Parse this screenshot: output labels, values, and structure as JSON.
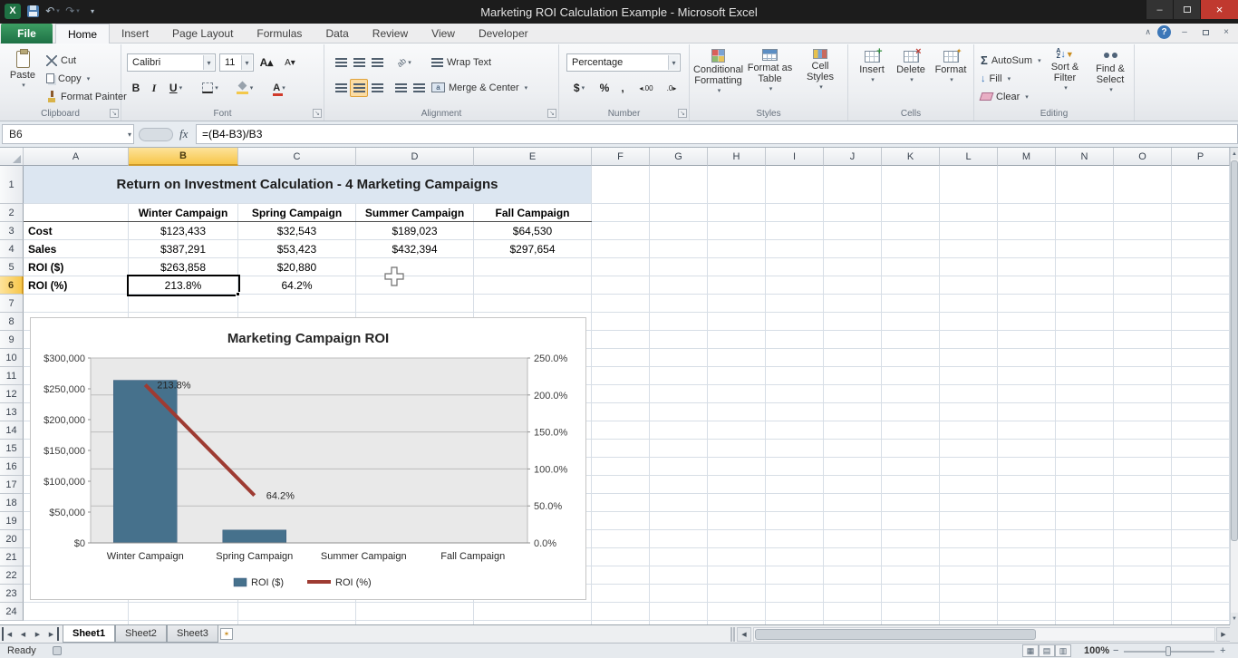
{
  "title_bar": {
    "title": "Marketing ROI Calculation Example  -  Microsoft Excel"
  },
  "ribbon": {
    "file_tab": "File",
    "tabs": [
      "Home",
      "Insert",
      "Page Layout",
      "Formulas",
      "Data",
      "Review",
      "View",
      "Developer"
    ],
    "active_tab": "Home",
    "clipboard": {
      "label": "Clipboard",
      "paste": "Paste",
      "cut": "Cut",
      "copy": "Copy",
      "format_painter": "Format Painter"
    },
    "font": {
      "label": "Font",
      "font_name": "Calibri",
      "font_size": "11"
    },
    "alignment": {
      "label": "Alignment",
      "wrap_text": "Wrap Text",
      "merge_center": "Merge & Center"
    },
    "number": {
      "label": "Number",
      "format": "Percentage"
    },
    "styles": {
      "label": "Styles",
      "conditional_formatting": "Conditional Formatting",
      "format_as_table": "Format as Table",
      "cell_styles": "Cell Styles"
    },
    "cells": {
      "label": "Cells",
      "insert": "Insert",
      "delete": "Delete",
      "format": "Format"
    },
    "editing": {
      "label": "Editing",
      "autosum": "AutoSum",
      "fill": "Fill",
      "clear": "Clear",
      "sort_filter": "Sort & Filter",
      "find_select": "Find & Select"
    }
  },
  "formula_bar": {
    "name_box": "B6",
    "fx": "fx",
    "formula": "=(B4-B3)/B3"
  },
  "sheet": {
    "columns": [
      "A",
      "B",
      "C",
      "D",
      "E",
      "F",
      "G",
      "H",
      "I",
      "J",
      "K",
      "L",
      "M",
      "N",
      "O",
      "P"
    ],
    "visible_rows": 24,
    "selected_column": "B",
    "selected_row": 6,
    "selection": {
      "ref": "B6",
      "value": "213.8%"
    },
    "cells": [
      {
        "ref": "A1",
        "text": "Return on Investment Calculation - 4 Marketing Campaigns"
      },
      {
        "ref": "B2",
        "text": "Winter Campaign"
      },
      {
        "ref": "C2",
        "text": "Spring Campaign"
      },
      {
        "ref": "D2",
        "text": "Summer Campaign"
      },
      {
        "ref": "E2",
        "text": "Fall Campaign"
      },
      {
        "ref": "A3",
        "text": "Cost"
      },
      {
        "ref": "B3",
        "text": "$123,433"
      },
      {
        "ref": "C3",
        "text": "$32,543"
      },
      {
        "ref": "D3",
        "text": "$189,023"
      },
      {
        "ref": "E3",
        "text": "$64,530"
      },
      {
        "ref": "A4",
        "text": "Sales"
      },
      {
        "ref": "B4",
        "text": "$387,291"
      },
      {
        "ref": "C4",
        "text": "$53,423"
      },
      {
        "ref": "D4",
        "text": "$432,394"
      },
      {
        "ref": "E4",
        "text": "$297,654"
      },
      {
        "ref": "A5",
        "text": "ROI ($)"
      },
      {
        "ref": "B5",
        "text": "$263,858"
      },
      {
        "ref": "C5",
        "text": "$20,880"
      },
      {
        "ref": "A6",
        "text": "ROI (%)"
      },
      {
        "ref": "B6",
        "text": "213.8%"
      },
      {
        "ref": "C6",
        "text": "64.2%"
      }
    ]
  },
  "chart_data": {
    "type": "bar",
    "title": "Marketing Campaign ROI",
    "categories": [
      "Winter Campaign",
      "Spring Campaign",
      "Summer Campaign",
      "Fall Campaign"
    ],
    "series": [
      {
        "name": "ROI ($)",
        "chart_type": "bar",
        "axis": "primary",
        "color": "#46718C",
        "values": [
          263858,
          20880,
          null,
          null
        ]
      },
      {
        "name": "ROI (%)",
        "chart_type": "line",
        "axis": "secondary",
        "color": "#9E3B32",
        "values": [
          213.8,
          64.2,
          null,
          null
        ],
        "point_labels": [
          "213.8%",
          "64.2%",
          null,
          null
        ]
      }
    ],
    "primary_axis": {
      "min": 0,
      "max": 300000,
      "step": 50000,
      "labels": [
        "$0",
        "$50,000",
        "$100,000",
        "$150,000",
        "$200,000",
        "$250,000",
        "$300,000"
      ]
    },
    "secondary_axis": {
      "min": 0,
      "max": 250,
      "step": 50,
      "labels": [
        "0.0%",
        "50.0%",
        "100.0%",
        "150.0%",
        "200.0%",
        "250.0%"
      ]
    },
    "legend": [
      "ROI ($)",
      "ROI (%)"
    ],
    "legend_position": "bottom",
    "plot_background": "#E9E9E9",
    "grid": true
  },
  "tabs_bar": {
    "sheets": [
      "Sheet1",
      "Sheet2",
      "Sheet3"
    ],
    "active_sheet": "Sheet1"
  },
  "status_bar": {
    "mode": "Ready",
    "zoom_level": "100%"
  }
}
